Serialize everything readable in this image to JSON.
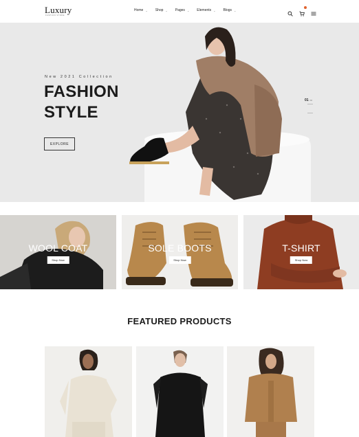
{
  "header": {
    "logo": "Luxury",
    "logo_tagline": "FASHION STORE",
    "nav": [
      {
        "label": "Home"
      },
      {
        "label": "Shop"
      },
      {
        "label": "Pages"
      },
      {
        "label": "Elements"
      },
      {
        "label": "Blogs"
      }
    ],
    "icons": [
      "search-icon",
      "cart-icon",
      "menu-icon"
    ]
  },
  "hero": {
    "tag": "New 2021 Collection",
    "title_line1": "FASHION",
    "title_line2": "STYLE",
    "button": "EXPLORE",
    "slide_number": "01",
    "slide_suffix": "/ 03"
  },
  "categories": [
    {
      "title": "WOOL COAT",
      "button": "Shop Now"
    },
    {
      "title": "SOLE BOOTS",
      "button": "Shop Now"
    },
    {
      "title": "T-SHIRT",
      "button": "Shop Now"
    }
  ],
  "featured": {
    "heading": "FEATURED PRODUCTS"
  },
  "colors": {
    "accent": "#e0622d",
    "hero_bg": "#e9e9e9",
    "text": "#1b1b1b"
  }
}
